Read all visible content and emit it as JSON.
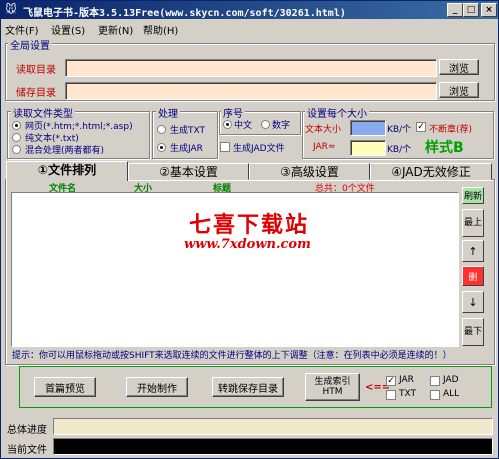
{
  "window": {
    "title": "飞鼠电子书-版本3.5.13Free(www.skycn.com/soft/30261.html)",
    "min": "_",
    "max": "□",
    "close": "×"
  },
  "menu": [
    "文件(F)",
    "设置(S)",
    "更新(N)",
    "帮助(H)"
  ],
  "global": {
    "group_label": "全局设置",
    "read_dir_label": "读取目录",
    "save_dir_label": "储存目录",
    "read_dir_value": "",
    "save_dir_value": "",
    "browse1": "浏览",
    "browse2": "浏览"
  },
  "filetype": {
    "group_label": "读取文件类型",
    "options": [
      "网页(*.htm;*.html;*.asp)",
      "纯文本(*.txt)",
      "混合处理(两者都有)"
    ]
  },
  "process": {
    "group_label": "处理",
    "gen_txt": "生成TXT",
    "gen_jar": "生成JAR",
    "gen_jad": "生成JAD文件"
  },
  "order": {
    "group_label": "序号",
    "chinese": "中文",
    "digit": "数字"
  },
  "size": {
    "group_label": "设置每个大小",
    "text_size_label": "文本大小",
    "jar_label": "JAR≈",
    "kb_unit": "KB/个",
    "kb_unit2": "KB/个",
    "no_break": "不断章(荐)",
    "style": "样式B"
  },
  "tabs": [
    "①文件排列",
    "②基本设置",
    "③高级设置",
    "④JAD无效修正"
  ],
  "list": {
    "col_filename": "文件名",
    "col_size": "大小",
    "col_title": "标题",
    "col_total": "总共：0个文件",
    "watermark1": "七喜下载站",
    "watermark2": "www.7xdown.com"
  },
  "side_buttons": {
    "refresh": "刷新",
    "top": "最上",
    "up": "↑",
    "delete": "删",
    "down": "↓",
    "bottom": "最下"
  },
  "hint": "提示：你可以用鼠标拖动或按SHIFT来选取连续的文件进行整体的上下调整（注意：在列表中必须是连续的！）",
  "actions": {
    "preview": "首篇预览",
    "start": "开始制作",
    "goto_save": "转跳保存目录",
    "gen_index": "生成索引 HTM",
    "arrow": "<==",
    "jar": "JAR",
    "jad": "JAD",
    "txt": "TXT",
    "all": "ALL"
  },
  "status": {
    "total_label": "总体进度",
    "current_label": "当前文件"
  }
}
